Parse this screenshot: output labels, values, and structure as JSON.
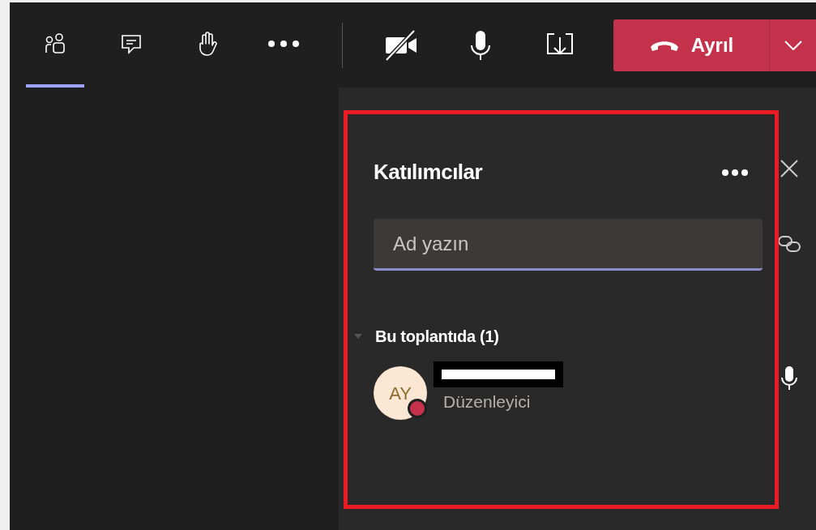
{
  "toolbar": {
    "tools": [
      {
        "kind": "people",
        "selected": true
      },
      {
        "kind": "chat",
        "selected": false
      },
      {
        "kind": "hand",
        "selected": false
      },
      {
        "kind": "more",
        "selected": false
      }
    ],
    "controls": [
      {
        "kind": "camera-off"
      },
      {
        "kind": "mic"
      },
      {
        "kind": "share"
      }
    ],
    "leave_button": {
      "label": "Ayrıl"
    }
  },
  "participants_panel": {
    "title": "Katılımcılar",
    "search": {
      "placeholder": "Ad yazın"
    },
    "section": {
      "label": "Bu toplantıda (1)",
      "expanded": true
    },
    "participants": [
      {
        "initials": "AY",
        "role": "Düzenleyici",
        "color": "#c4314b",
        "name_redacted": true
      }
    ]
  }
}
